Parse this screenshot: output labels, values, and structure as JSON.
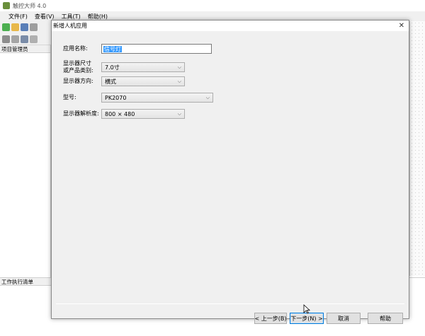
{
  "app": {
    "title": "触控大师 4.0"
  },
  "menu": [
    {
      "label": "文件(F)"
    },
    {
      "label": "查看(V)"
    },
    {
      "label": "工具(T)"
    },
    {
      "label": "帮助(H)"
    }
  ],
  "left_panel": {
    "title": "项目管理员"
  },
  "bottom_panel": {
    "title": "工作执行清单"
  },
  "dialog": {
    "title": "新增人机应用",
    "fields": {
      "app_name": {
        "label": "应用名称:",
        "value": "信号灯"
      },
      "display_size": {
        "label_line1": "显示器尺寸",
        "label_line2": "或产品类别:",
        "value": "7.0寸"
      },
      "orientation": {
        "label": "显示器方向:",
        "value": "横式"
      },
      "model": {
        "label": "型号:",
        "value": "PK2070"
      },
      "resolution": {
        "label": "显示器解析度:",
        "value": "800 × 480"
      }
    },
    "buttons": {
      "back": "< 上一步(B)",
      "next": "下一步(N) >",
      "cancel": "取消",
      "help": "帮助"
    }
  },
  "colors": {
    "accent": "#0078d7",
    "selection": "#3399ff"
  }
}
